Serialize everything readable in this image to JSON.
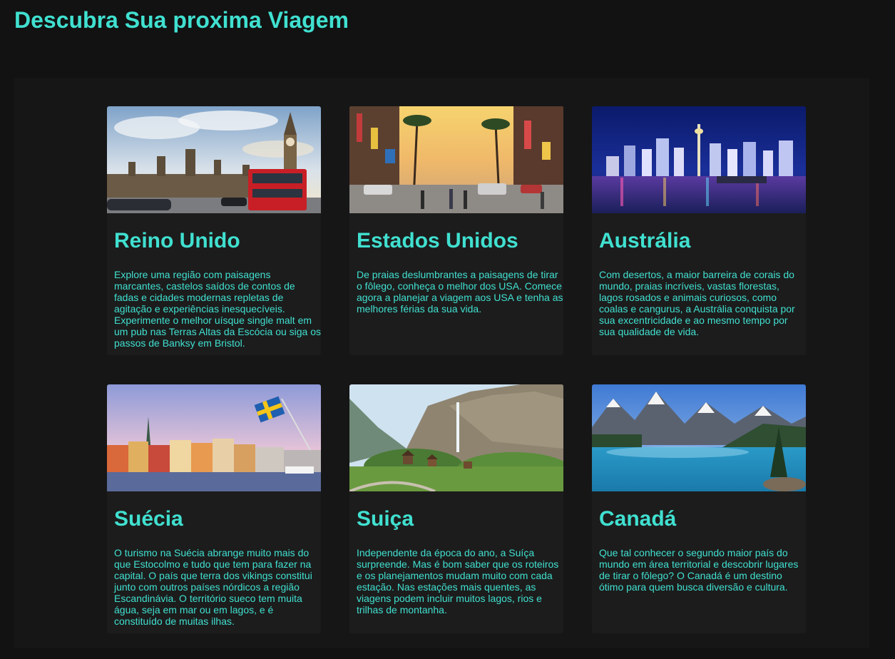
{
  "page": {
    "title": "Descubra Sua proxima Viagem"
  },
  "destinations": [
    {
      "name": "Reino Unido",
      "image": "london-westminster-photo",
      "description": "Explore uma região com paisagens marcantes, castelos saídos de contos de fadas e cidades modernas repletas de agitação e experiências inesquecíveis. Experimente o melhor uísque single malt em um pub nas Terras Altas da Escócia ou siga os passos de Banksy em Bristol."
    },
    {
      "name": "Estados Unidos",
      "image": "hollywood-boulevard-photo",
      "description": "De praias deslumbrantes a paisagens de tirar o fôlego, conheça o melhor dos USA. Comece agora a planejar a viagem aos USA e tenha as melhores férias da sua vida."
    },
    {
      "name": "Austrália",
      "image": "sydney-night-skyline-photo",
      "description": "Com desertos, a maior barreira de corais do mundo, praias incríveis, vastas florestas, lagos rosados e animais curiosos, como coalas e cangurus, a Austrália conquista por sua excentricidade e ao mesmo tempo por sua qualidade de vida."
    },
    {
      "name": "Suécia",
      "image": "stockholm-waterfront-photo",
      "description": "O turismo na Suécia abrange muito mais do que Estocolmo e tudo que tem para fazer na capital. O país que terra dos vikings constitui junto com outros países nórdicos a região Escandinávia. O território sueco tem muita água, seja em mar ou em lagos, e é constituído de muitas ilhas."
    },
    {
      "name": "Suiça",
      "image": "lauterbrunnen-valley-photo",
      "description": "Independente da época do ano, a Suíça surpreende. Mas é bom saber que os roteiros e os planejamentos mudam muito com cada estação. Nas estações mais quentes, as viagens podem incluir muitos lagos, rios e trilhas de montanha."
    },
    {
      "name": "Canadá",
      "image": "moraine-lake-photo",
      "description": "Que tal conhecer o segundo maior país do mundo em área territorial e descobrir lugares de tirar o fôlego? O Canadá é um destino ótimo para quem busca diversão e cultura."
    }
  ],
  "colors": {
    "accent": "#40e0d0",
    "background": "#121212",
    "panel": "#161616",
    "card": "#1c1c1c"
  }
}
